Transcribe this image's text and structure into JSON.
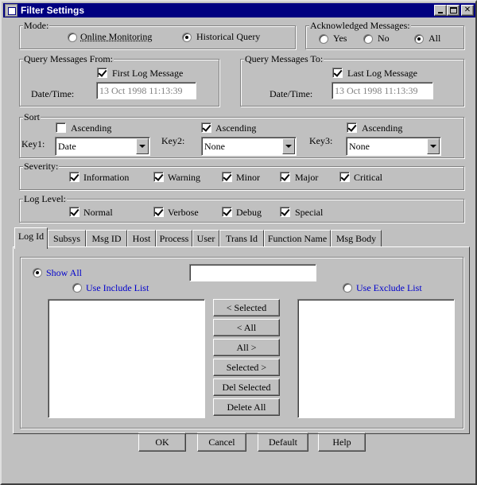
{
  "window": {
    "title": "Filter Settings"
  },
  "mode": {
    "title": "Mode:",
    "options": [
      "Online Monitoring",
      "Historical Query"
    ],
    "selected": "Historical Query"
  },
  "ack": {
    "title": "Acknowledged Messages:",
    "options": [
      "Yes",
      "No",
      "All"
    ],
    "selected": "All"
  },
  "query_from": {
    "title": "Query Messages From:",
    "checkbox_label": "First Log Message",
    "checked": true,
    "datetime_label": "Date/Time:",
    "datetime_value": "13 Oct 1998 11:13:39"
  },
  "query_to": {
    "title": "Query Messages To:",
    "checkbox_label": "Last Log Message",
    "checked": true,
    "datetime_label": "Date/Time:",
    "datetime_value": "13 Oct 1998 11:13:39"
  },
  "sort": {
    "title": "Sort",
    "keys": [
      {
        "label": "Key1:",
        "ascending_label": "Ascending",
        "ascending": false,
        "value": "Date"
      },
      {
        "label": "Key2:",
        "ascending_label": "Ascending",
        "ascending": true,
        "value": "None"
      },
      {
        "label": "Key3:",
        "ascending_label": "Ascending",
        "ascending": true,
        "value": "None"
      }
    ]
  },
  "severity": {
    "title": "Severity:",
    "items": [
      {
        "label": "Information",
        "checked": true
      },
      {
        "label": "Warning",
        "checked": true
      },
      {
        "label": "Minor",
        "checked": true
      },
      {
        "label": "Major",
        "checked": true
      },
      {
        "label": "Critical",
        "checked": true
      }
    ]
  },
  "log_level": {
    "title": "Log Level:",
    "items": [
      {
        "label": "Normal",
        "checked": true
      },
      {
        "label": "Verbose",
        "checked": true
      },
      {
        "label": "Debug",
        "checked": true
      },
      {
        "label": "Special",
        "checked": true
      }
    ]
  },
  "tabs": [
    "Log Id",
    "Subsys",
    "Msg ID",
    "Host",
    "Process",
    "User",
    "Trans Id",
    "Function Name",
    "Msg Body"
  ],
  "active_tab": "Log Id",
  "panel": {
    "show_all_label": "Show All",
    "include_label": "Use Include List",
    "exclude_label": "Use Exclude List",
    "filter_value": "",
    "buttons": [
      "< Selected",
      "< All",
      "All >",
      "Selected >",
      "Del Selected",
      "Delete All"
    ]
  },
  "footer": {
    "ok": "OK",
    "cancel": "Cancel",
    "default": "Default",
    "help": "Help"
  },
  "colors": {
    "title_bar": "#000080",
    "face": "#c0c0c0",
    "link_text": "#0000cc"
  }
}
